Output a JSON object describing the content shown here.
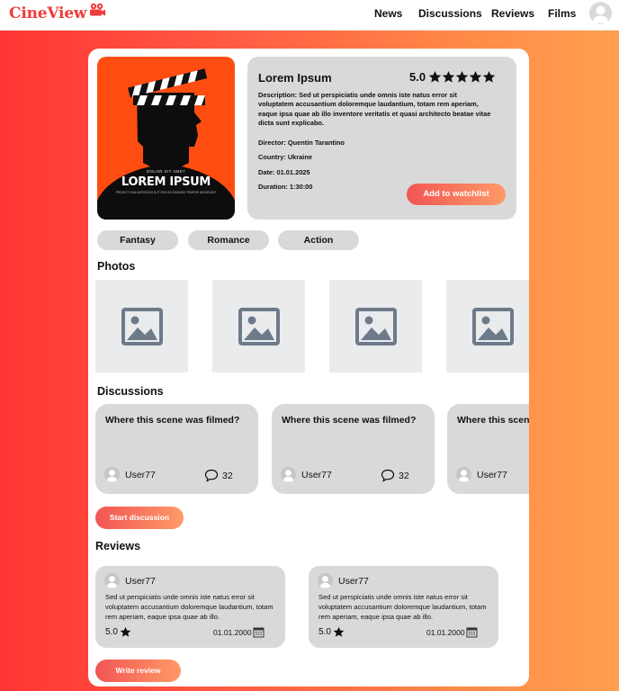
{
  "brand": {
    "name": "CineView",
    "accent": "#ef3b3b"
  },
  "nav": {
    "items": [
      "News",
      "Discussions",
      "Reviews",
      "Films"
    ]
  },
  "movie": {
    "title": "Lorem Ipsum",
    "rating": "5.0",
    "stars": 5,
    "description": "Description: Sed ut perspiciatis unde omnis iste natus error sit voluptatem accusantium doloremque laudantium, totam rem aperiam, eaque ipsa quae ab illo inventore veritatis et quasi architecto beatae vitae dicta sunt explicabo.",
    "director": "Director: Quentin Tarantino",
    "country": "Country: Ukraine",
    "date": "Date:  01.01.2025",
    "duration": "Duration: 1:30:00",
    "watchlist_label": "Add to watchlist",
    "poster": {
      "small_text": "DOLOR SIT AMET",
      "big_text": "LOREM IPSUM",
      "footer_text": "PROJECT EAN ADIPISCING ELIT SED DO EIUSMOD TEMPOR INCIDIDUNT"
    }
  },
  "genres": [
    "Fantasy",
    "Romance",
    "Action"
  ],
  "photos": {
    "title": "Photos",
    "count": 4
  },
  "discussions": {
    "title": "Discussions",
    "items": [
      {
        "title": "Where this scene was filmed?",
        "user": "User77",
        "comments": "32"
      },
      {
        "title": "Where this scene was filmed?",
        "user": "User77",
        "comments": "32"
      },
      {
        "title": "Where this scene was filmed?",
        "user": "User77",
        "comments": ""
      }
    ],
    "start_label": "Start discussion"
  },
  "reviews": {
    "title": "Reviews",
    "items": [
      {
        "user": "User77",
        "text": "Sed ut perspiciatis unde omnis iste natus error sit voluptatem accusantium doloremque laudantium, totam rem aperiam, eaque ipsa quae ab illo.",
        "score": "5.0",
        "date": "01.01.2000"
      },
      {
        "user": "User77",
        "text": "Sed ut perspiciatis unde omnis iste natus error sit voluptatem accusantium doloremque laudantium, totam rem aperiam, eaque ipsa quae ab illo.",
        "score": "5.0",
        "date": "01.01.2000"
      }
    ],
    "write_label": "Write review"
  }
}
